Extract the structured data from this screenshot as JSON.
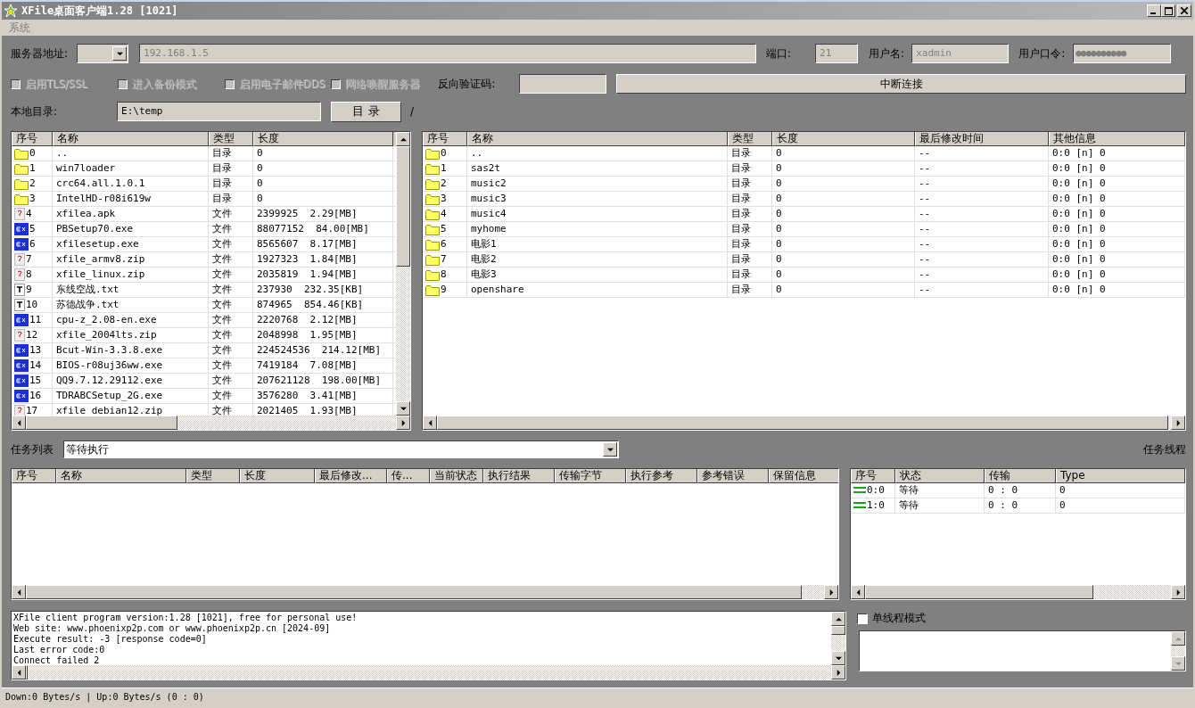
{
  "window": {
    "title": "XFile桌面客户端1.28 [1021]"
  },
  "menu": [
    {
      "label": "系统",
      "disabled": true
    }
  ],
  "server": {
    "label": "服务器地址:",
    "address": "192.168.1.5",
    "port_label": "端口:",
    "port": "21",
    "user_label": "用户名:",
    "user": "xadmin",
    "password_label": "用户口令:",
    "password": "●●●●●●●●●●",
    "disabled": true
  },
  "options": [
    {
      "label": "启用TLS/SSL",
      "checked": false,
      "disabled": true
    },
    {
      "label": "进入备份模式",
      "checked": false,
      "disabled": true
    },
    {
      "label": "启用电子邮件DDS",
      "checked": false,
      "disabled": true
    },
    {
      "label": "网络唤醒服务器",
      "checked": false,
      "disabled": true
    }
  ],
  "verify": {
    "label": "反向验证码:"
  },
  "disconnect_button": "中断连接",
  "local": {
    "label": "本地目录:",
    "path": "E:\\temp",
    "button": "目 录",
    "remote_path": "/"
  },
  "local_table": {
    "columns": [
      "序号",
      "名称",
      "类型",
      "长度"
    ],
    "rows": [
      {
        "kind": "folder",
        "index": "0",
        "name": "..",
        "type": "目录",
        "size": "0"
      },
      {
        "kind": "folder",
        "index": "1",
        "name": "win7loader",
        "type": "目录",
        "size": "0"
      },
      {
        "kind": "folder",
        "index": "2",
        "name": "crc64.all.1.0.1",
        "type": "目录",
        "size": "0"
      },
      {
        "kind": "folder",
        "index": "3",
        "name": "IntelHD-r08i619w",
        "type": "目录",
        "size": "0"
      },
      {
        "kind": "unknown",
        "index": "4",
        "name": "xfilea.apk",
        "type": "文件",
        "size": "2399925  2.29[MB]"
      },
      {
        "kind": "exe",
        "index": "5",
        "name": "PBSetup70.exe",
        "type": "文件",
        "size": "88077152  84.00[MB]"
      },
      {
        "kind": "exe",
        "index": "6",
        "name": "xfilesetup.exe",
        "type": "文件",
        "size": "8565607  8.17[MB]"
      },
      {
        "kind": "unknown",
        "index": "7",
        "name": "xfile_armv8.zip",
        "type": "文件",
        "size": "1927323  1.84[MB]"
      },
      {
        "kind": "unknown",
        "index": "8",
        "name": "xfile_linux.zip",
        "type": "文件",
        "size": "2035819  1.94[MB]"
      },
      {
        "kind": "text",
        "index": "9",
        "name": "东线空战.txt",
        "type": "文件",
        "size": "237930  232.35[KB]"
      },
      {
        "kind": "text",
        "index": "10",
        "name": "苏德战争.txt",
        "type": "文件",
        "size": "874965  854.46[KB]"
      },
      {
        "kind": "exe",
        "index": "11",
        "name": "cpu-z_2.08-en.exe",
        "type": "文件",
        "size": "2220768  2.12[MB]"
      },
      {
        "kind": "unknown",
        "index": "12",
        "name": "xfile_2004lts.zip",
        "type": "文件",
        "size": "2048998  1.95[MB]"
      },
      {
        "kind": "exe",
        "index": "13",
        "name": "Bcut-Win-3.3.8.exe",
        "type": "文件",
        "size": "224524536  214.12[MB]"
      },
      {
        "kind": "exe",
        "index": "14",
        "name": "BIOS-r08uj36ww.exe",
        "type": "文件",
        "size": "7419184  7.08[MB]"
      },
      {
        "kind": "exe",
        "index": "15",
        "name": "QQ9.7.12.29112.exe",
        "type": "文件",
        "size": "207621128  198.00[MB]"
      },
      {
        "kind": "exe",
        "index": "16",
        "name": "TDRABCSetup_2G.exe",
        "type": "文件",
        "size": "3576280  3.41[MB]"
      },
      {
        "kind": "unknown",
        "index": "17",
        "name": "xfile_debian12.zip",
        "type": "文件",
        "size": "2021405  1.93[MB]"
      }
    ]
  },
  "remote_table": {
    "columns": [
      "序号",
      "名称",
      "类型",
      "长度",
      "最后修改时间",
      "其他信息"
    ],
    "rows": [
      {
        "kind": "folder",
        "index": "0",
        "name": "..",
        "type": "目录",
        "size": "0",
        "modified": "--",
        "info": "0:0 [n] 0"
      },
      {
        "kind": "folder",
        "index": "1",
        "name": "sas2t",
        "type": "目录",
        "size": "0",
        "modified": "--",
        "info": "0:0 [n] 0"
      },
      {
        "kind": "folder",
        "index": "2",
        "name": "music2",
        "type": "目录",
        "size": "0",
        "modified": "--",
        "info": "0:0 [n] 0"
      },
      {
        "kind": "folder",
        "index": "3",
        "name": "music3",
        "type": "目录",
        "size": "0",
        "modified": "--",
        "info": "0:0 [n] 0"
      },
      {
        "kind": "folder",
        "index": "4",
        "name": "music4",
        "type": "目录",
        "size": "0",
        "modified": "--",
        "info": "0:0 [n] 0"
      },
      {
        "kind": "folder",
        "index": "5",
        "name": "myhome",
        "type": "目录",
        "size": "0",
        "modified": "--",
        "info": "0:0 [n] 0"
      },
      {
        "kind": "folder",
        "index": "6",
        "name": "电影1",
        "type": "目录",
        "size": "0",
        "modified": "--",
        "info": "0:0 [n] 0"
      },
      {
        "kind": "folder",
        "index": "7",
        "name": "电影2",
        "type": "目录",
        "size": "0",
        "modified": "--",
        "info": "0:0 [n] 0"
      },
      {
        "kind": "folder",
        "index": "8",
        "name": "电影3",
        "type": "目录",
        "size": "0",
        "modified": "--",
        "info": "0:0 [n] 0"
      },
      {
        "kind": "folder",
        "index": "9",
        "name": "openshare",
        "type": "目录",
        "size": "0",
        "modified": "--",
        "info": "0:0 [n] 0"
      }
    ]
  },
  "tasks": {
    "label": "任务列表",
    "filter": "等待执行",
    "threads_label": "任务线程"
  },
  "task_table": {
    "columns": [
      "序号",
      "名称",
      "类型",
      "长度",
      "最后修改...",
      "传...",
      "当前状态",
      "执行结果",
      "传输字节",
      "执行参考",
      "参考错误",
      "保留信息"
    ]
  },
  "thread_table": {
    "columns": [
      "序号",
      "状态",
      "传输",
      "Type"
    ],
    "rows": [
      {
        "index": "0:0",
        "status": "等待",
        "transfer": "0 : 0",
        "type": "0"
      },
      {
        "index": "1:0",
        "status": "等待",
        "transfer": "0 : 0",
        "type": "0"
      }
    ]
  },
  "log": [
    "XFile client program version:1.28 [1021], free for personal use!",
    "Web site: www.phoenixp2p.com or www.phoenixp2p.cn [2024-09]",
    "Execute result: -3 [response code=0]",
    "Last error code:0",
    "Connect failed 2"
  ],
  "single_thread": {
    "label": "单线程模式",
    "checked": false
  },
  "status_bar": "Down:0 Bytes/s | Up:0 Bytes/s (0 : 0)"
}
